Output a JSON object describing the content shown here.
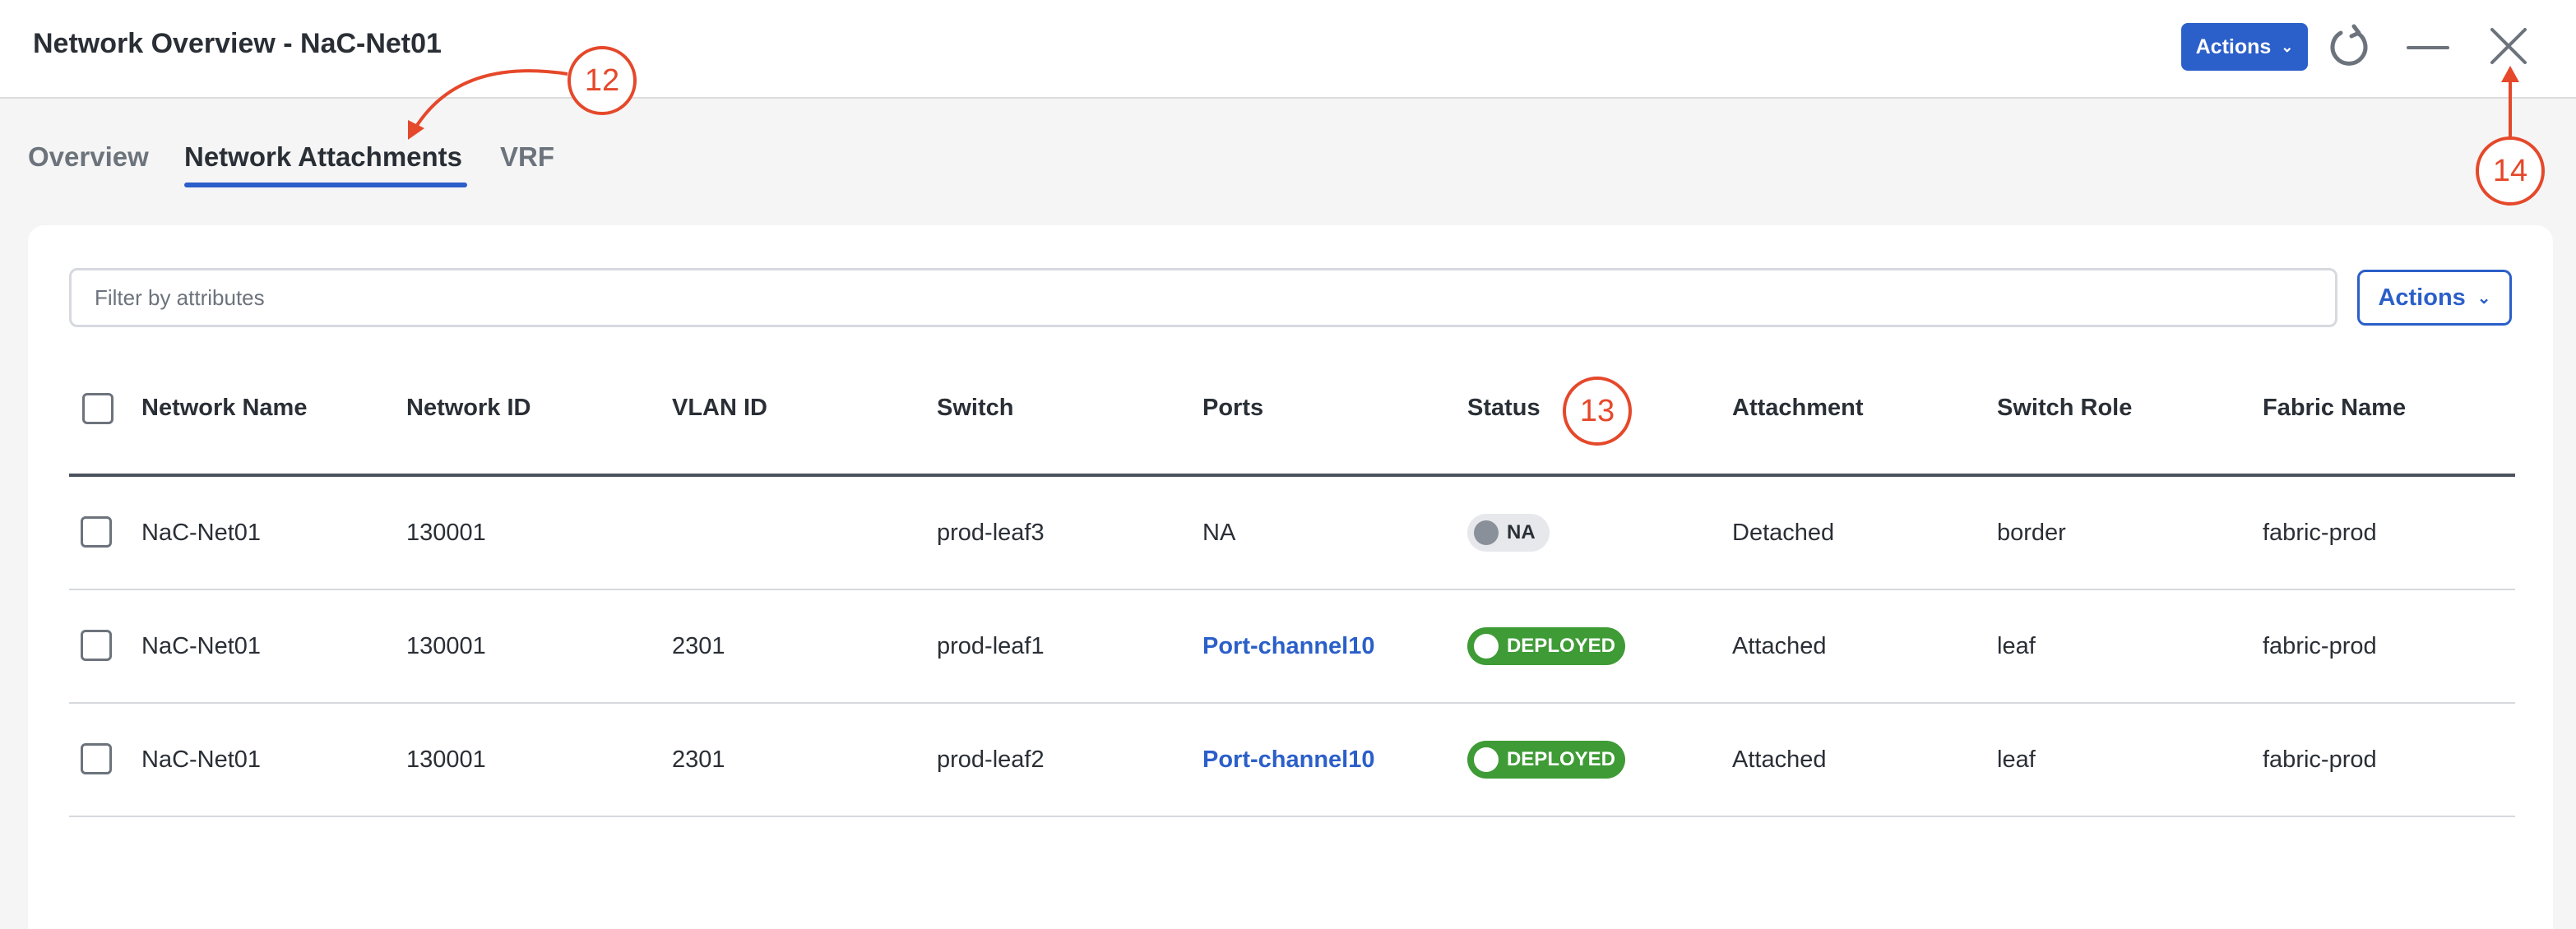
{
  "header": {
    "title": "Network Overview - NaC-Net01",
    "actions_label": "Actions"
  },
  "tabs": [
    {
      "label": "Overview"
    },
    {
      "label": "Network Attachments"
    },
    {
      "label": "VRF"
    }
  ],
  "toolbar": {
    "filter_placeholder": "Filter by attributes",
    "filter_value": "",
    "actions_label": "Actions"
  },
  "table": {
    "columns": [
      "Network Name",
      "Network ID",
      "VLAN ID",
      "Switch",
      "Ports",
      "Status",
      "Attachment",
      "Switch Role",
      "Fabric Name"
    ],
    "rows": [
      {
        "network_name": "NaC-Net01",
        "network_id": "130001",
        "vlan_id": "",
        "switch": "prod-leaf3",
        "ports": "NA",
        "status": "NA",
        "attachment": "Detached",
        "switch_role": "border",
        "fabric_name": "fabric-prod"
      },
      {
        "network_name": "NaC-Net01",
        "network_id": "130001",
        "vlan_id": "2301",
        "switch": "prod-leaf1",
        "ports": "Port-channel10",
        "status": "DEPLOYED",
        "attachment": "Attached",
        "switch_role": "leaf",
        "fabric_name": "fabric-prod"
      },
      {
        "network_name": "NaC-Net01",
        "network_id": "130001",
        "vlan_id": "2301",
        "switch": "prod-leaf2",
        "ports": "Port-channel10",
        "status": "DEPLOYED",
        "attachment": "Attached",
        "switch_role": "leaf",
        "fabric_name": "fabric-prod"
      }
    ]
  },
  "callouts": [
    {
      "number": "12"
    },
    {
      "number": "13"
    },
    {
      "number": "14"
    }
  ],
  "colors": {
    "accent": "#2b5fc9",
    "callout": "#e5482a",
    "deployed": "#3e9b35",
    "na": "#8a9099"
  },
  "icons": [
    "chevron-down-icon",
    "refresh-icon",
    "minimize-icon",
    "close-icon"
  ]
}
